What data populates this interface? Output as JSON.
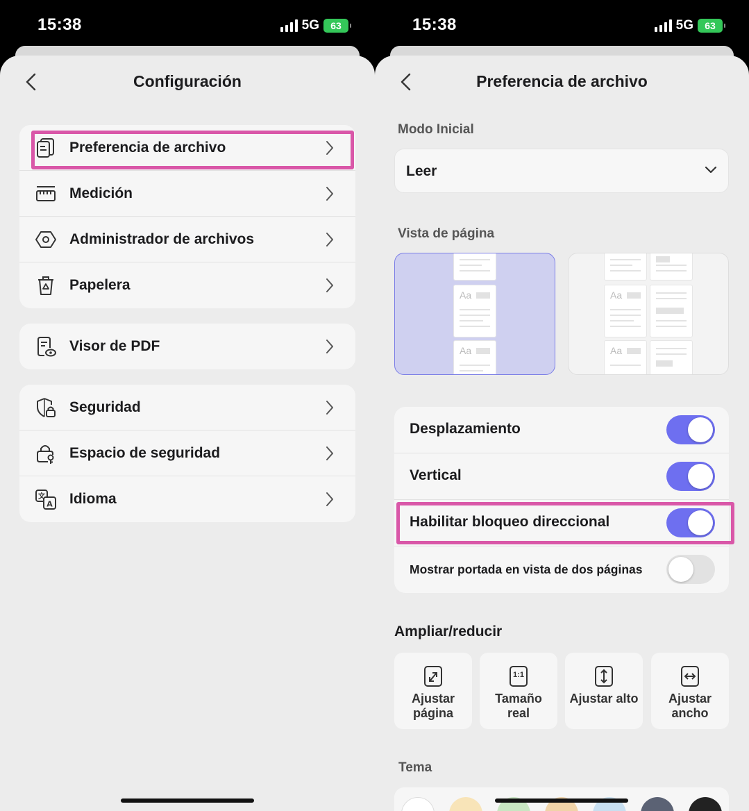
{
  "status": {
    "time": "15:38",
    "network": "5G",
    "battery": "63"
  },
  "left": {
    "title": "Configuración",
    "groups": [
      [
        {
          "label": "Preferencia de archivo",
          "icon": "file-preference-icon"
        },
        {
          "label": "Medición",
          "icon": "ruler-icon"
        },
        {
          "label": "Administrador de archivos",
          "icon": "hexagon-icon"
        },
        {
          "label": "Papelera",
          "icon": "trash-icon"
        }
      ],
      [
        {
          "label": "Visor de PDF",
          "icon": "pdf-viewer-icon"
        }
      ],
      [
        {
          "label": "Seguridad",
          "icon": "shield-lock-icon"
        },
        {
          "label": "Espacio de seguridad",
          "icon": "lock-key-icon"
        },
        {
          "label": "Idioma",
          "icon": "language-icon"
        }
      ]
    ]
  },
  "right": {
    "title": "Preferencia de archivo",
    "initial_mode_label": "Modo Inicial",
    "initial_mode_value": "Leer",
    "page_view_label": "Vista de página",
    "page_thumb_text": "Aa",
    "toggles": [
      {
        "label": "Desplazamiento",
        "on": true
      },
      {
        "label": "Vertical",
        "on": true
      },
      {
        "label": "Habilitar bloqueo direccional",
        "on": true
      },
      {
        "label": "Mostrar portada en vista de dos páginas",
        "on": false
      }
    ],
    "zoom_title": "Ampliar/reducir",
    "zoom_options": [
      {
        "line1": "Ajustar",
        "line2": "página",
        "icon": "fit-page-icon"
      },
      {
        "line1": "Tamaño",
        "line2": "real",
        "icon": "actual-size-icon",
        "badge": "1:1"
      },
      {
        "line1": "Ajustar alto",
        "line2": "",
        "icon": "fit-height-icon"
      },
      {
        "line1": "Ajustar",
        "line2": "ancho",
        "icon": "fit-width-icon"
      }
    ],
    "theme_label": "Tema"
  },
  "colors": {
    "accent": "#6e6ff0",
    "highlight": "#d957a8",
    "selected_view_bg": "#cfd0f0",
    "swatches": [
      "#ffffff",
      "#f8e4b8",
      "#c8e6c2",
      "#f0d3a8",
      "#c8dff0",
      "#5b6274",
      "#222222"
    ]
  }
}
